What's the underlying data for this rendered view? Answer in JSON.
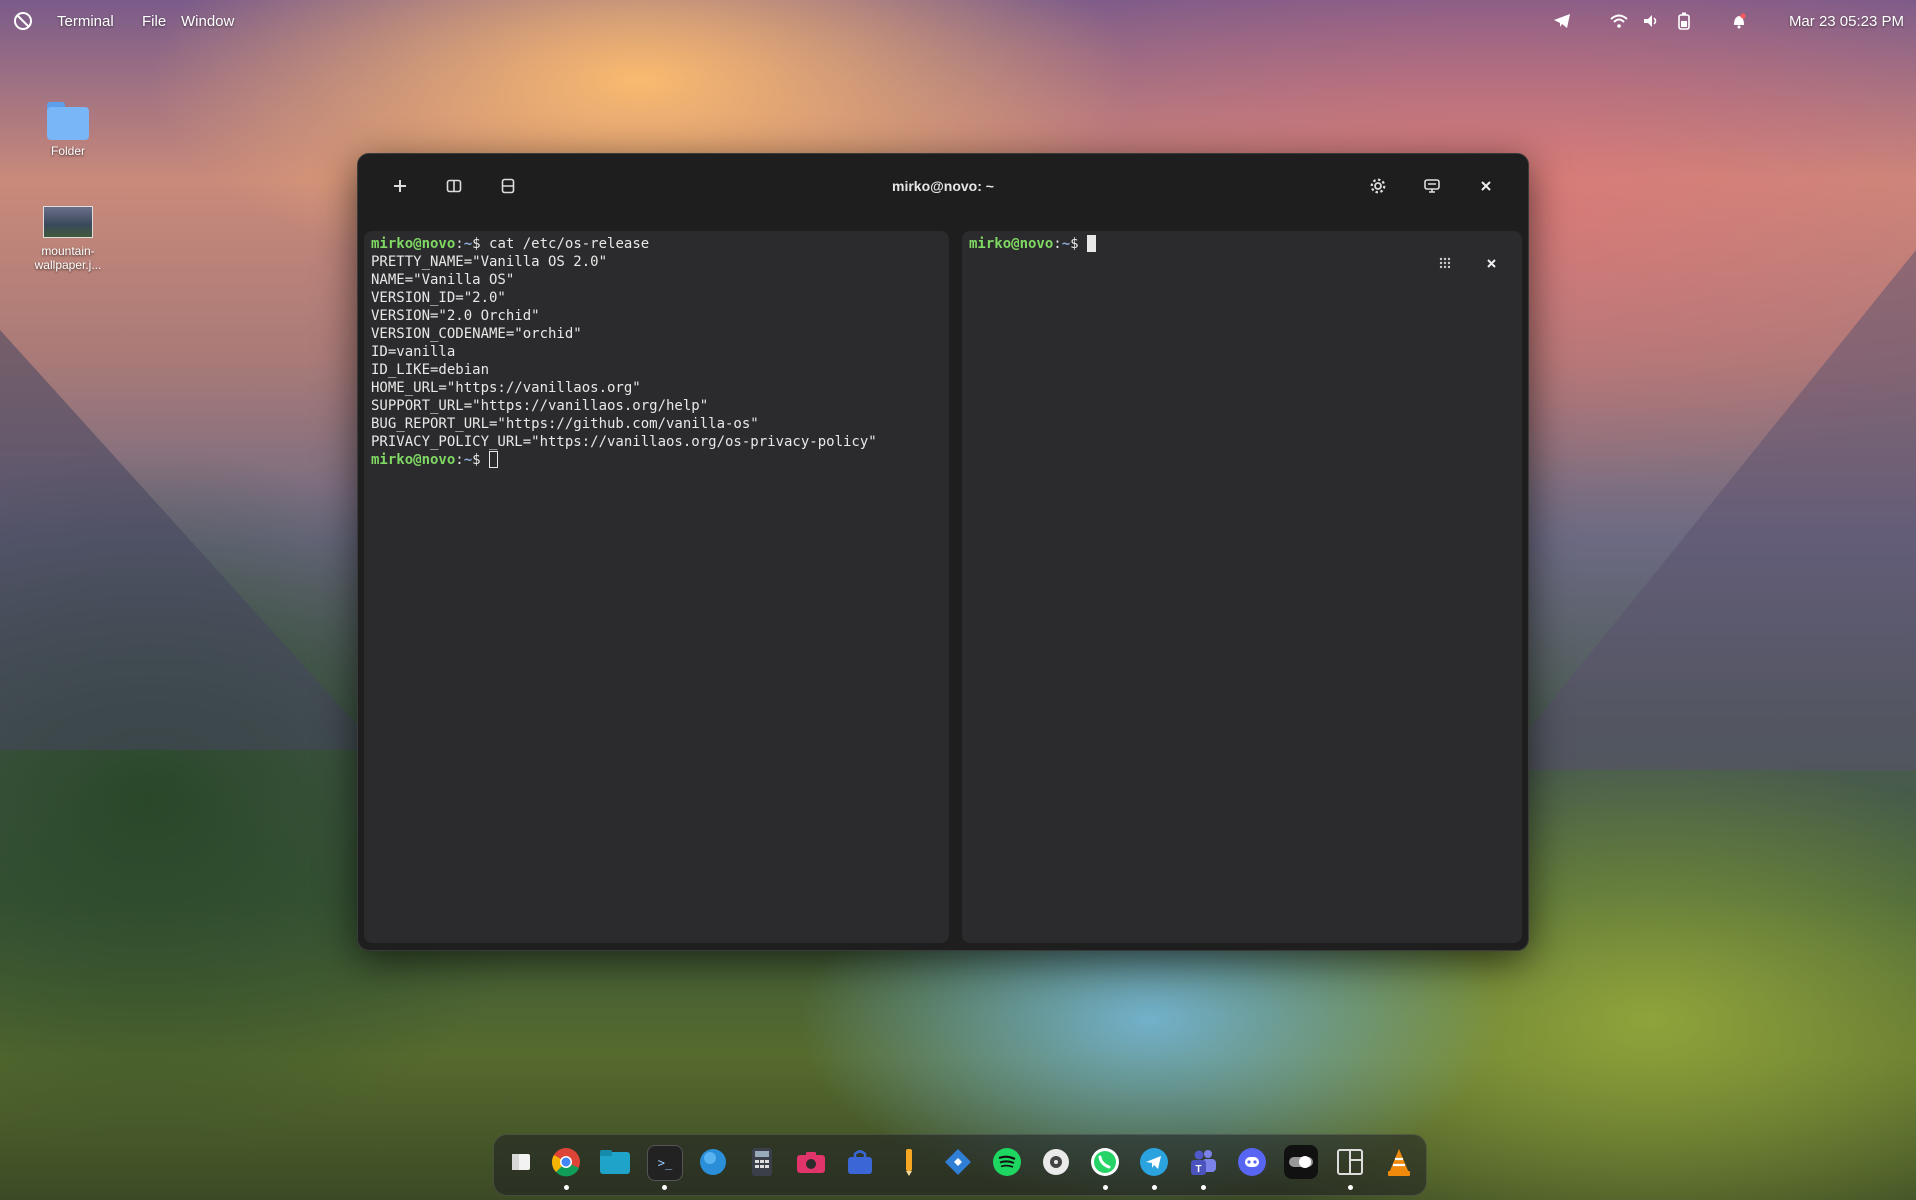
{
  "topbar": {
    "app_name": "Terminal",
    "menus": [
      "File",
      "Window"
    ],
    "clock": "Mar 23  05:23 PM"
  },
  "desktop": {
    "icons": [
      {
        "label": "Folder",
        "icon": "folder-icon"
      },
      {
        "label": "mountain-wallpaper.j...",
        "icon": "image-thumbnail-icon"
      }
    ]
  },
  "window": {
    "title": "mirko@novo: ~",
    "left_pane": {
      "prompt_user": "mirko@novo",
      "prompt_path": "~",
      "command": "cat /etc/os-release",
      "output": [
        "PRETTY_NAME=\"Vanilla OS 2.0\"",
        "NAME=\"Vanilla OS\"",
        "VERSION_ID=\"2.0\"",
        "VERSION=\"2.0 Orchid\"",
        "VERSION_CODENAME=\"orchid\"",
        "ID=vanilla",
        "ID_LIKE=debian",
        "HOME_URL=\"https://vanillaos.org\"",
        "SUPPORT_URL=\"https://vanillaos.org/help\"",
        "BUG_REPORT_URL=\"https://github.com/vanilla-os\"",
        "PRIVACY_POLICY_URL=\"https://vanillaos.org/os-privacy-policy\""
      ]
    },
    "right_pane": {
      "prompt_user": "mirko@novo",
      "prompt_path": "~"
    }
  },
  "dock": {
    "apps": [
      {
        "name": "files-manager",
        "icon": "files-icon",
        "running": false
      },
      {
        "name": "chrome",
        "icon": "chrome-icon",
        "running": true
      },
      {
        "name": "files",
        "icon": "folder-icon",
        "running": false
      },
      {
        "name": "terminal",
        "icon": "terminal-icon",
        "running": true
      },
      {
        "name": "browser",
        "icon": "globe-icon",
        "running": false
      },
      {
        "name": "calculator",
        "icon": "calculator-icon",
        "running": false
      },
      {
        "name": "camera",
        "icon": "camera-icon",
        "running": false
      },
      {
        "name": "software",
        "icon": "bag-icon",
        "running": false
      },
      {
        "name": "pencil",
        "icon": "pencil-icon",
        "running": false
      },
      {
        "name": "code",
        "icon": "code-icon",
        "running": false
      },
      {
        "name": "spotify",
        "icon": "spotify-icon",
        "running": false
      },
      {
        "name": "disk",
        "icon": "disk-icon",
        "running": false
      },
      {
        "name": "whatsapp",
        "icon": "whatsapp-icon",
        "running": true
      },
      {
        "name": "telegram",
        "icon": "telegram-icon",
        "running": true
      },
      {
        "name": "teams",
        "icon": "teams-icon",
        "running": true
      },
      {
        "name": "discord",
        "icon": "discord-icon",
        "running": false
      },
      {
        "name": "toggle",
        "icon": "toggle-icon",
        "running": false
      },
      {
        "name": "layout",
        "icon": "layout-icon",
        "running": true
      },
      {
        "name": "vlc",
        "icon": "vlc-icon",
        "running": false
      }
    ]
  }
}
